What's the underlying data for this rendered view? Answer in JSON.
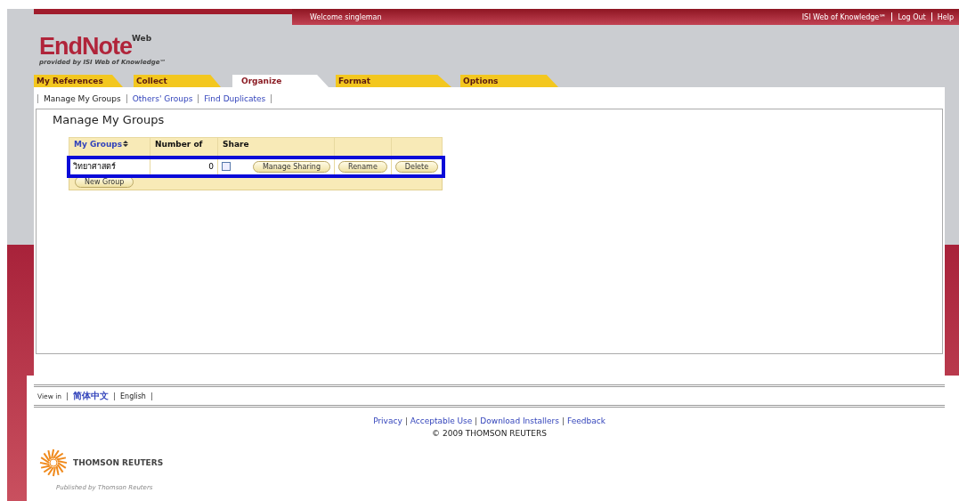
{
  "top_bar": {
    "welcome": "Welcome singleman",
    "links": [
      "ISI Web of Knowledge℠",
      "Log Out",
      "Help"
    ]
  },
  "logo": {
    "name": "EndNote",
    "superscript": "Web",
    "tagline": "provided by ISI Web of Knowledge℠"
  },
  "tabs": [
    {
      "label": "My References",
      "selected": false
    },
    {
      "label": "Collect",
      "selected": false
    },
    {
      "label": "Organize",
      "selected": true
    },
    {
      "label": "Format",
      "selected": false
    },
    {
      "label": "Options",
      "selected": false
    }
  ],
  "subtabs": [
    {
      "label": "Manage My Groups",
      "selected": true
    },
    {
      "label": "Others' Groups",
      "selected": false
    },
    {
      "label": "Find Duplicates",
      "selected": false
    }
  ],
  "page_title": "Manage My Groups",
  "table": {
    "columns": [
      "My Groups",
      "Number of",
      "Share"
    ],
    "rows": [
      {
        "name": "วิทยาศาสตร์",
        "count": "0",
        "shared": false,
        "highlighted": true,
        "actions": [
          "Manage Sharing",
          "Rename",
          "Delete"
        ]
      }
    ],
    "new_group": "New Group"
  },
  "footer": {
    "view_in": "View in",
    "languages": [
      {
        "label": "简体中文",
        "selected": false
      },
      {
        "label": "English",
        "selected": true
      }
    ],
    "links": [
      "Privacy",
      "Acceptable Use",
      "Download Installers",
      "Feedback"
    ],
    "copyright": "© 2009 THOMSON REUTERS",
    "brand": "THOMSON REUTERS",
    "published": "Published by Thomson Reuters"
  }
}
